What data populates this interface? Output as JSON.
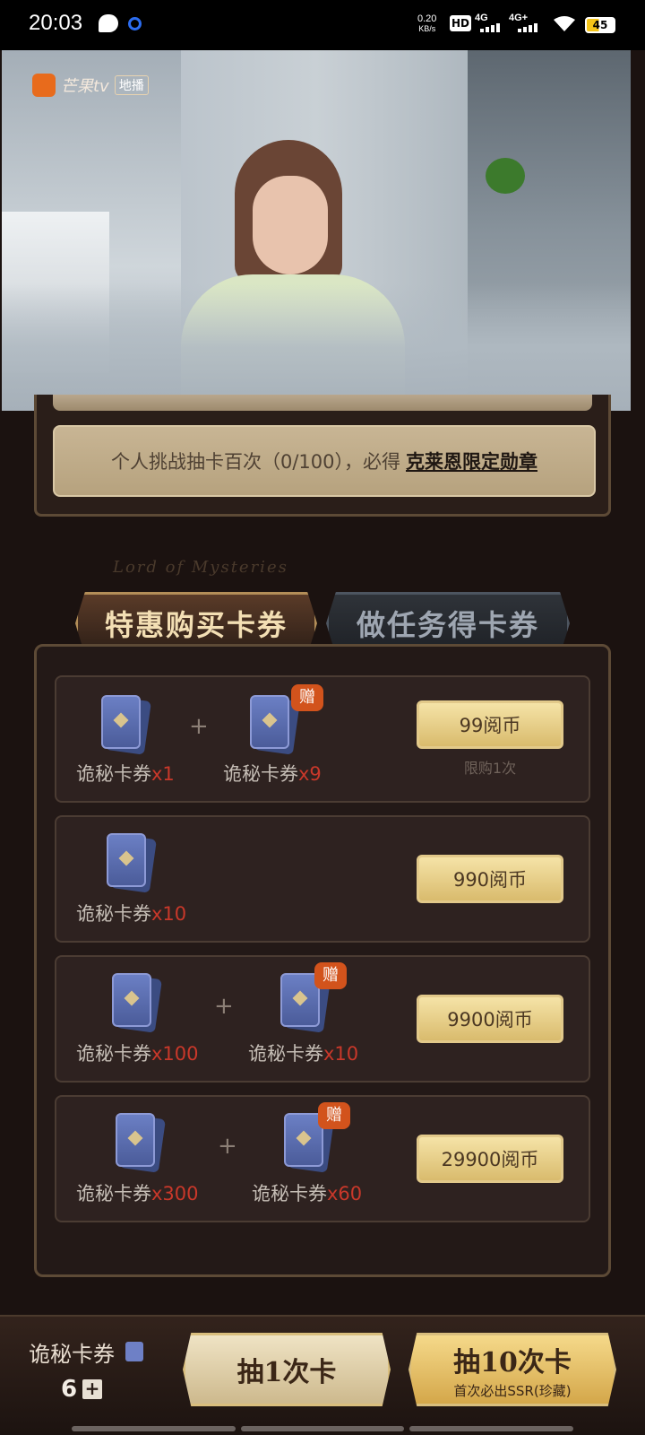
{
  "status_bar": {
    "time": "20:03",
    "net_speed_value": "0.20",
    "net_speed_unit": "KB/s",
    "hd_label": "HD",
    "signal1": "4G",
    "signal2": "4G+",
    "battery": "45"
  },
  "video": {
    "brand": "芒果tv",
    "tag": "地播"
  },
  "challenge": {
    "text": "个人挑战抽卡百次（0/100），必得",
    "link": "克莱恩限定勋章"
  },
  "tabs": {
    "deco_title": "Lord of Mysteries",
    "active": "特惠购买卡券",
    "inactive": "做任务得卡券"
  },
  "offers": [
    {
      "base_label": "诡秘卡券",
      "base_qty": "x1",
      "bonus_label": "诡秘卡券",
      "bonus_qty": "x9",
      "gift": "赠",
      "price": "99阅币",
      "note": "限购1次"
    },
    {
      "base_label": "诡秘卡券",
      "base_qty": "x10",
      "price": "990阅币"
    },
    {
      "base_label": "诡秘卡券",
      "base_qty": "x100",
      "bonus_label": "诡秘卡券",
      "bonus_qty": "x10",
      "gift": "赠",
      "price": "9900阅币"
    },
    {
      "base_label": "诡秘卡券",
      "base_qty": "x300",
      "bonus_label": "诡秘卡券",
      "bonus_qty": "x60",
      "gift": "赠",
      "price": "29900阅币"
    }
  ],
  "bottom": {
    "balance_label": "诡秘卡券",
    "balance_count": "6",
    "add_symbol": "+",
    "draw_one": "抽1次卡",
    "draw_ten": "抽10次卡",
    "draw_ten_sub": "首次必出SSR(珍藏)"
  },
  "icons": [
    "message-icon",
    "circle-icon",
    "wifi-icon",
    "battery-icon",
    "ticket-icon",
    "add-icon"
  ],
  "colors": {
    "accent_gold": "#d9bb6d",
    "quantity_red": "#c9382a",
    "gift_orange": "#d2531c"
  }
}
